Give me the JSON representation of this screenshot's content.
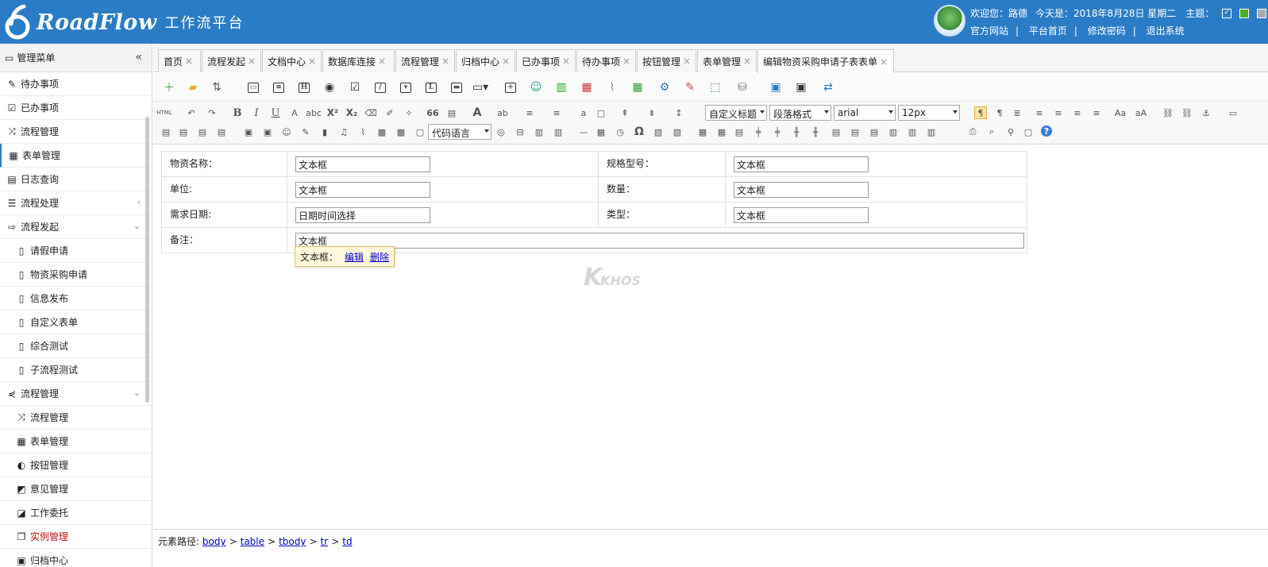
{
  "header": {
    "logo_text": "RoadFlow",
    "subtitle": "工作流平台",
    "welcome": "欢迎您：路德",
    "today": "今天是：2018年8月28日 星期二",
    "theme_label": "主题：",
    "links": [
      "官方网站",
      "平台首页",
      "修改密码",
      "退出系统"
    ]
  },
  "sidebar": {
    "title": "管理菜单",
    "collapse_icon": "«",
    "items": [
      {
        "label": "待办事项",
        "icon": "edit-icon",
        "glyph": "✎",
        "level": 0
      },
      {
        "label": "已办事项",
        "icon": "check-square-icon",
        "glyph": "☑",
        "level": 0
      },
      {
        "label": "流程管理",
        "icon": "shuffle-icon",
        "glyph": "⤨",
        "level": 0
      },
      {
        "label": "表单管理",
        "icon": "table-icon",
        "glyph": "▦",
        "level": 0,
        "active": true
      },
      {
        "label": "日志查询",
        "icon": "file-icon",
        "glyph": "▤",
        "level": 0
      },
      {
        "label": "流程处理",
        "icon": "list-icon",
        "glyph": "☰",
        "level": 0,
        "arrow": "‹"
      },
      {
        "label": "流程发起",
        "icon": "sign-in-icon",
        "glyph": "⇨",
        "level": 0,
        "arrow": "⌄"
      },
      {
        "label": "请假申请",
        "icon": "document-icon",
        "glyph": "▯",
        "level": 1
      },
      {
        "label": "物资采购申请",
        "icon": "document-icon",
        "glyph": "▯",
        "level": 1
      },
      {
        "label": "信息发布",
        "icon": "document-icon",
        "glyph": "▯",
        "level": 1
      },
      {
        "label": "自定义表单",
        "icon": "document-icon",
        "glyph": "▯",
        "level": 1
      },
      {
        "label": "综合测试",
        "icon": "document-icon",
        "glyph": "▯",
        "level": 1
      },
      {
        "label": "子流程测试",
        "icon": "document-icon",
        "glyph": "▯",
        "level": 1
      },
      {
        "label": "流程管理",
        "icon": "share-icon",
        "glyph": "⋞",
        "level": 0,
        "arrow": "⌄"
      },
      {
        "label": "流程管理",
        "icon": "shuffle-icon",
        "glyph": "⤨",
        "level": 1
      },
      {
        "label": "表单管理",
        "icon": "table-icon",
        "glyph": "▦",
        "level": 1
      },
      {
        "label": "按钮管理",
        "icon": "toggle-icon",
        "glyph": "◐",
        "level": 1
      },
      {
        "label": "意见管理",
        "icon": "pencil-square-icon",
        "glyph": "◩",
        "level": 1
      },
      {
        "label": "工作委托",
        "icon": "share-square-icon",
        "glyph": "◪",
        "level": 1
      },
      {
        "label": "实例管理",
        "icon": "clone-icon",
        "glyph": "❐",
        "level": 1,
        "red": true
      },
      {
        "label": "归档中心",
        "icon": "briefcase-icon",
        "glyph": "▣",
        "level": 1
      }
    ]
  },
  "tabs": [
    {
      "label": "首页"
    },
    {
      "label": "流程发起"
    },
    {
      "label": "文档中心"
    },
    {
      "label": "数据库连接"
    },
    {
      "label": "流程管理"
    },
    {
      "label": "归档中心"
    },
    {
      "label": "已办事项"
    },
    {
      "label": "待办事项"
    },
    {
      "label": "按钮管理"
    },
    {
      "label": "表单管理"
    },
    {
      "label": "编辑物资采购申请子表表单",
      "active": true
    }
  ],
  "tab_close": "×",
  "toolbar": {
    "heading_select": "自定义标题",
    "paragraph_select": "段落格式",
    "font_select": "arial",
    "size_select": "12px",
    "code_lang_select": "代码语言",
    "html_label": "HTML",
    "bold": "B",
    "italic": "I",
    "underline": "U",
    "superscript": "X²",
    "subscript": "X₂",
    "quote": "66",
    "special_char": "Ω",
    "font_color": "A",
    "help": "?"
  },
  "form": {
    "rows": [
      [
        {
          "label": "物资名称："
        },
        {
          "value": "文本框"
        },
        {
          "label": "规格型号："
        },
        {
          "value": "文本框"
        }
      ],
      [
        {
          "label": "单位:"
        },
        {
          "value": "文本框"
        },
        {
          "label": "数量："
        },
        {
          "value": "文本框"
        }
      ],
      [
        {
          "label": "需求日期:"
        },
        {
          "value": "日期时间选择"
        },
        {
          "label": "类型："
        },
        {
          "value": "文本框"
        }
      ]
    ],
    "remark_label": "备注：",
    "remark_value": "文本框"
  },
  "tooltip": {
    "text": "文本框：",
    "edit": "编辑",
    "delete": "删除"
  },
  "pathbar": {
    "label": "元素路径:",
    "parts": [
      "body",
      "table",
      "tbody",
      "tr",
      "td"
    ],
    "sep": ">"
  }
}
